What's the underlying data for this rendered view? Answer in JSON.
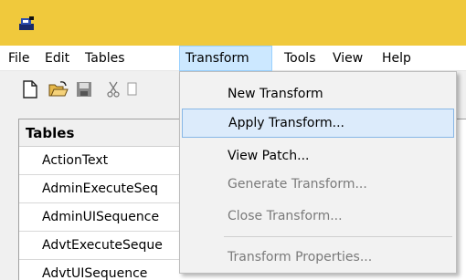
{
  "menubar": {
    "items": [
      {
        "label": "File"
      },
      {
        "label": "Edit"
      },
      {
        "label": "Tables"
      },
      {
        "label": "Transform"
      },
      {
        "label": "Tools"
      },
      {
        "label": "View"
      },
      {
        "label": "Help"
      }
    ],
    "active": "Transform"
  },
  "toolbar": {
    "icons": [
      "new-file-icon",
      "open-folder-icon",
      "save-icon",
      "cut-icon",
      "copy-icon"
    ]
  },
  "tables_pane": {
    "header": "Tables",
    "rows": [
      {
        "label": "ActionText"
      },
      {
        "label": "AdminExecuteSeq"
      },
      {
        "label": "AdminUISequence"
      },
      {
        "label": "AdvtExecuteSeque"
      },
      {
        "label": "AdvtUISequence"
      }
    ]
  },
  "transform_menu": {
    "items": [
      {
        "label": "New Transform",
        "enabled": true
      },
      {
        "label": "Apply Transform...",
        "enabled": true,
        "highlighted": true
      },
      {
        "label": "View Patch...",
        "enabled": true
      },
      {
        "label": "Generate Transform...",
        "enabled": false
      },
      {
        "label": "Close Transform...",
        "enabled": false
      },
      {
        "label": "Transform Properties...",
        "enabled": false
      }
    ]
  },
  "colors": {
    "titlebar": "#f0c93c",
    "menu_active_bg": "#cce8ff",
    "menu_hover_bg": "#dcebfb",
    "disabled_text": "#7a7a7a"
  }
}
